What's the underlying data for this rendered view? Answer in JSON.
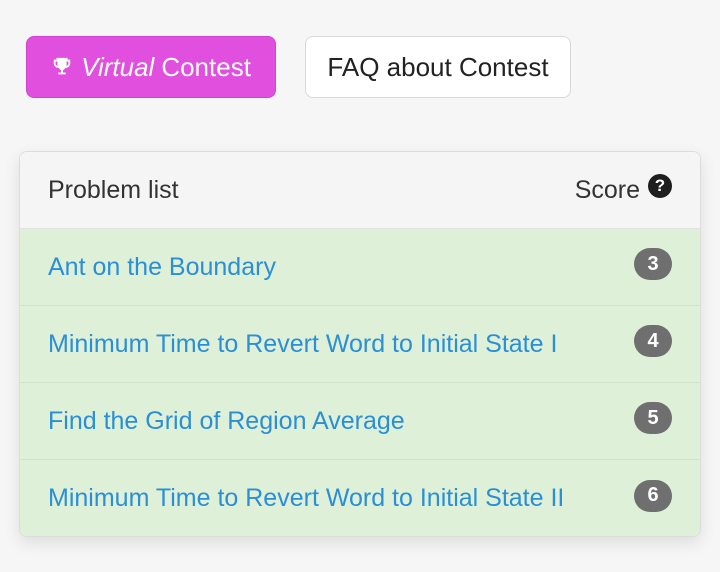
{
  "buttons": {
    "virtual_italic": "Virtual",
    "virtual_rest": "Contest",
    "faq": "FAQ about Contest"
  },
  "table": {
    "header_problems": "Problem list",
    "header_score": "Score",
    "help_glyph": "?",
    "rows": [
      {
        "title": "Ant on the Boundary",
        "score": "3"
      },
      {
        "title": "Minimum Time to Revert Word to Initial State I",
        "score": "4"
      },
      {
        "title": "Find the Grid of Region Average",
        "score": "5"
      },
      {
        "title": "Minimum Time to Revert Word to Initial State II",
        "score": "6"
      }
    ]
  },
  "icons": {
    "virtual_button_icon": "trophy-icon",
    "score_help_icon": "question-circle-icon"
  },
  "colors": {
    "virtual_button": "#e04fde",
    "row_solved": "#dff0d8",
    "link": "#2a8fd4",
    "badge": "#6f6f6f"
  }
}
